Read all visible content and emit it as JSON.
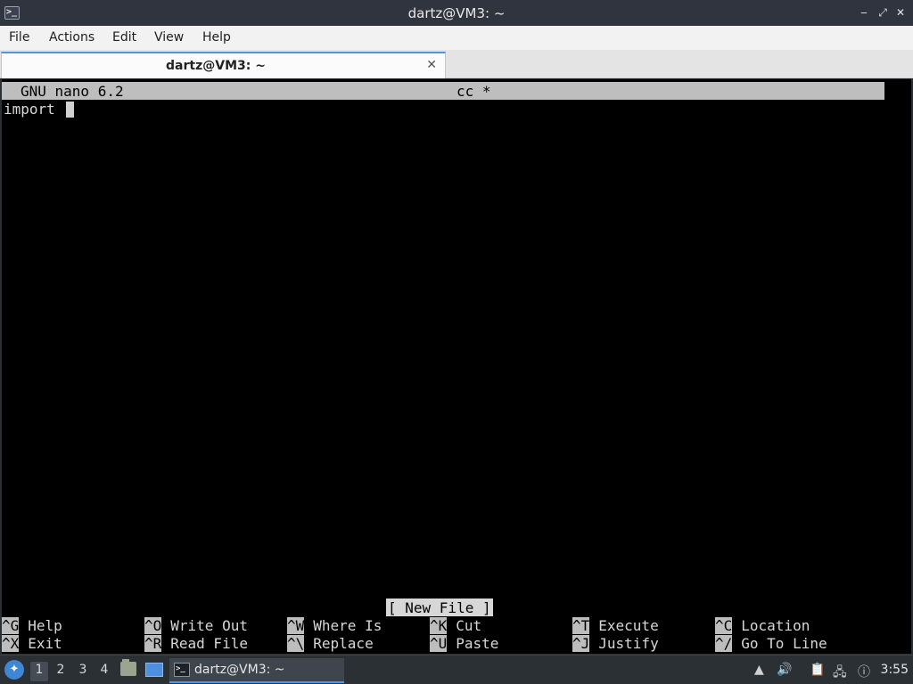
{
  "window": {
    "title": "dartz@VM3: ~",
    "app_icon": "terminal-icon",
    "controls": {
      "minimize": "‒",
      "maximize": "⤢",
      "close": "✕"
    }
  },
  "menu": [
    "File",
    "Actions",
    "Edit",
    "View",
    "Help"
  ],
  "tab": {
    "label": "dartz@VM3: ~",
    "close": "✕"
  },
  "nano": {
    "version": "GNU nano 6.2",
    "filename": "cc *",
    "line1": "import ",
    "status": "[ New File ]",
    "shortcuts": [
      {
        "key": "^G",
        "label": "Help"
      },
      {
        "key": "^O",
        "label": "Write Out"
      },
      {
        "key": "^W",
        "label": "Where Is"
      },
      {
        "key": "^K",
        "label": "Cut"
      },
      {
        "key": "^T",
        "label": "Execute"
      },
      {
        "key": "^C",
        "label": "Location"
      },
      {
        "key": "^X",
        "label": "Exit"
      },
      {
        "key": "^R",
        "label": "Read File"
      },
      {
        "key": "^\\",
        "label": "Replace"
      },
      {
        "key": "^U",
        "label": "Paste"
      },
      {
        "key": "^J",
        "label": "Justify"
      },
      {
        "key": "^/",
        "label": "Go To Line"
      }
    ]
  },
  "taskbar": {
    "workspaces": [
      "1",
      "2",
      "3",
      "4"
    ],
    "active_workspace": "1",
    "task_label": "dartz@VM3: ~",
    "clock": "3:55",
    "accent": "#5294e2"
  }
}
